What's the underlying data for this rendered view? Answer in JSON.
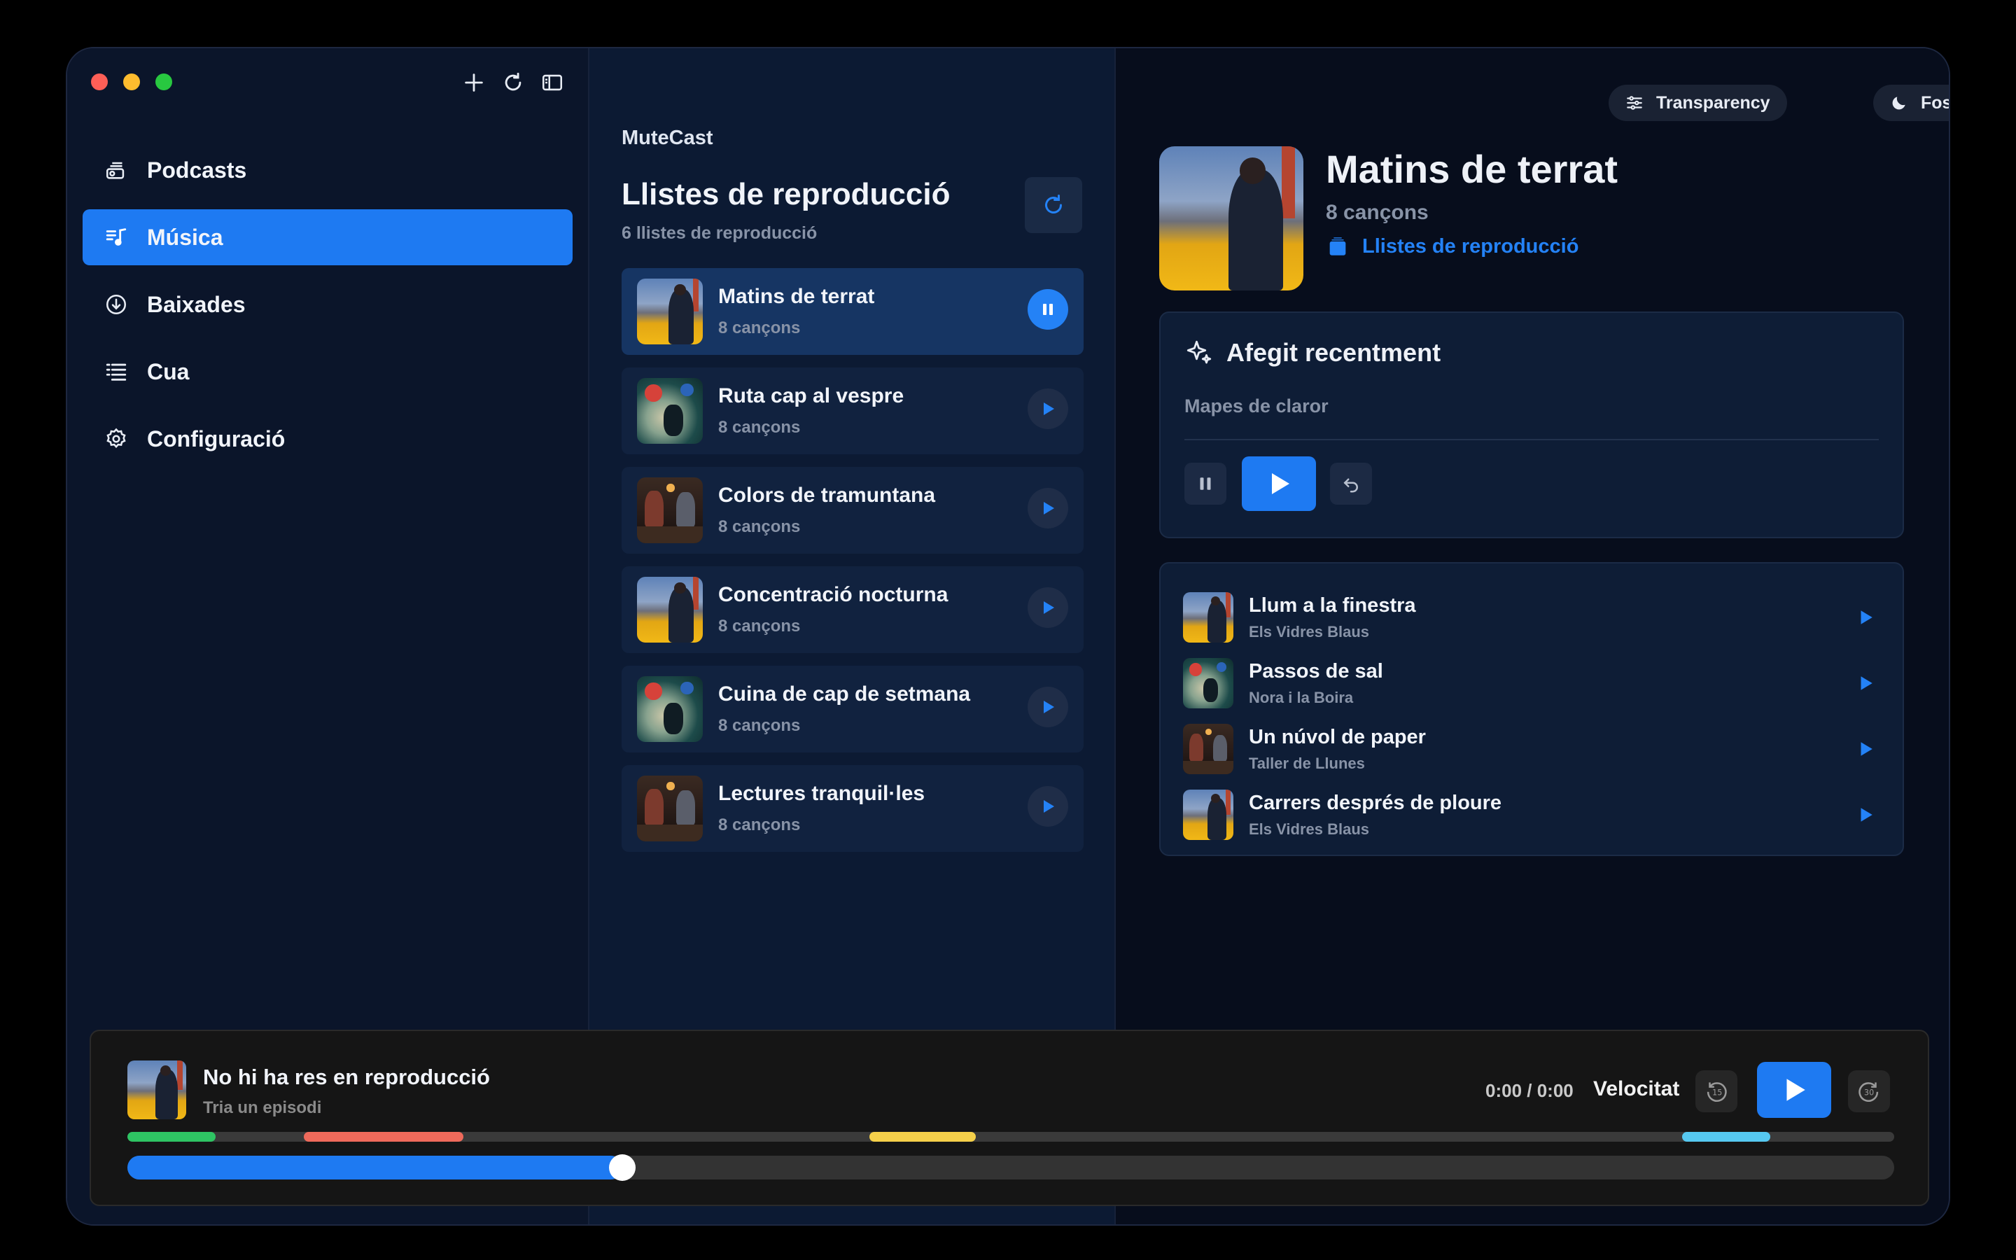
{
  "sidebar": {
    "tools": [
      {
        "icon": "plus-icon"
      },
      {
        "icon": "refresh-icon"
      },
      {
        "icon": "sidebar-toggle-icon"
      }
    ],
    "items": [
      {
        "label": "Podcasts",
        "icon": "podcasts-icon",
        "active": false
      },
      {
        "label": "Música",
        "icon": "music-icon",
        "active": true
      },
      {
        "label": "Baixades",
        "icon": "download-icon",
        "active": false
      },
      {
        "label": "Cua",
        "icon": "queue-icon",
        "active": false
      },
      {
        "label": "Configuració",
        "icon": "gear-icon",
        "active": false
      }
    ]
  },
  "middle": {
    "app_name": "MuteCast",
    "title": "Llistes de reproducció",
    "subtitle": "6 llistes de reproducció",
    "playlists": [
      {
        "name": "Matins de terrat",
        "count": "8 cançons",
        "art": "city",
        "playing": true
      },
      {
        "name": "Ruta cap al vespre",
        "count": "8 cançons",
        "art": "map",
        "playing": false
      },
      {
        "name": "Colors de tramuntana",
        "count": "8 cançons",
        "art": "desk",
        "playing": false
      },
      {
        "name": "Concentració nocturna",
        "count": "8 cançons",
        "art": "city",
        "playing": false
      },
      {
        "name": "Cuina de cap de setmana",
        "count": "8 cançons",
        "art": "map",
        "playing": false
      },
      {
        "name": "Lectures tranquil·les",
        "count": "8 cançons",
        "art": "desk",
        "playing": false
      }
    ]
  },
  "right": {
    "transparency_label": "Transparency",
    "theme_label": "Fosc",
    "title": "Matins de terrat",
    "subtitle": "8 cançons",
    "link": "Llistes de reproducció",
    "recent": {
      "heading": "Afegit recentment",
      "item": "Mapes de claror"
    },
    "tracks": [
      {
        "name": "Llum a la finestra",
        "artist": "Els Vidres Blaus",
        "art": "city"
      },
      {
        "name": "Passos de sal",
        "artist": "Nora i la Boira",
        "art": "map"
      },
      {
        "name": "Un núvol de paper",
        "artist": "Taller de Llunes",
        "art": "desk"
      },
      {
        "name": "Carrers després de ploure",
        "artist": "Els Vidres Blaus",
        "art": "city"
      }
    ]
  },
  "player": {
    "title": "No hi ha res en reproducció",
    "subtitle": "Tria un episodi",
    "time": "0:00 / 0:00",
    "speed_label": "Velocitat",
    "progress": 0.28,
    "chapters": [
      {
        "start": 0.0,
        "end": 0.05,
        "color": "#2ec463"
      },
      {
        "start": 0.1,
        "end": 0.19,
        "color": "#ef6a5b"
      },
      {
        "start": 0.42,
        "end": 0.48,
        "color": "#f5d04a"
      },
      {
        "start": 0.88,
        "end": 0.93,
        "color": "#56c8f0"
      }
    ]
  },
  "colors": {
    "accent": "#1e7af2",
    "sidebar_bg": "#0b152a"
  }
}
